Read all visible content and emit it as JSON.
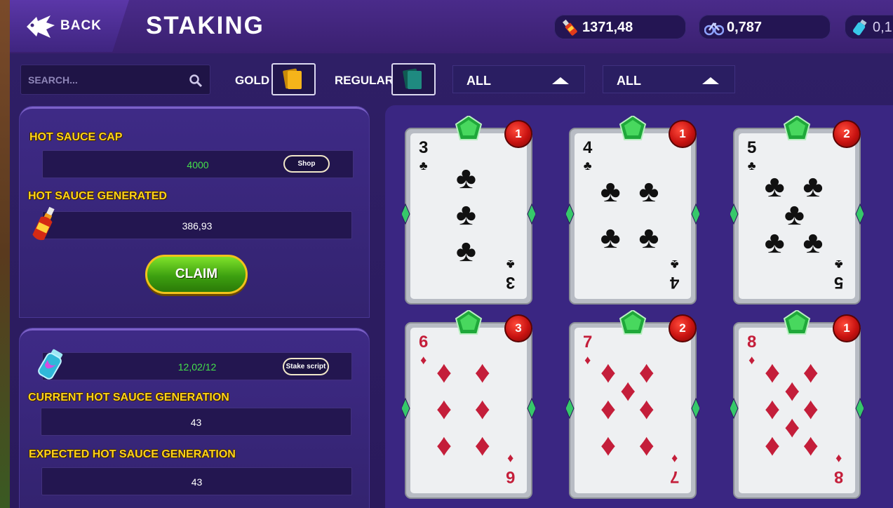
{
  "header": {
    "back_label": "BACK",
    "title": "STAKING",
    "resources": [
      {
        "icon": "hot-sauce-bottle-icon",
        "value": "1371,48"
      },
      {
        "icon": "bicycle-icon",
        "value": "0,787"
      },
      {
        "icon": "potion-vial-icon",
        "value": "0,1"
      }
    ]
  },
  "filters": {
    "search_placeholder": "SEARCH...",
    "gold_label": "GOLD",
    "regular_label": "REGULAR",
    "dropdown1": "ALL",
    "dropdown2": "ALL",
    "gold_color": "#f5b41a",
    "regular_color": "#1f8a80"
  },
  "sauce_panel": {
    "cap_label": "HOT SAUCE CAP",
    "cap_value": "4000",
    "shop_label": "Shop",
    "generated_label": "HOT SAUCE GENERATED",
    "generated_value": "386,93",
    "claim_label": "CLAIM"
  },
  "script_panel": {
    "script_value": "12,02/12",
    "stake_script_label": "Stake script",
    "current_label": "CURRENT HOT SAUCE GENERATION",
    "current_value": "43",
    "expected_label": "EXPECTED HOT SAUCE GENERATION",
    "expected_value": "43"
  },
  "cards": [
    {
      "rank": "3",
      "suit": "club",
      "badge": "1"
    },
    {
      "rank": "4",
      "suit": "club",
      "badge": "1"
    },
    {
      "rank": "5",
      "suit": "club",
      "badge": "2"
    },
    {
      "rank": "6",
      "suit": "diamond",
      "badge": "3"
    },
    {
      "rank": "7",
      "suit": "diamond",
      "badge": "2"
    },
    {
      "rank": "8",
      "suit": "diamond",
      "badge": "1"
    }
  ]
}
